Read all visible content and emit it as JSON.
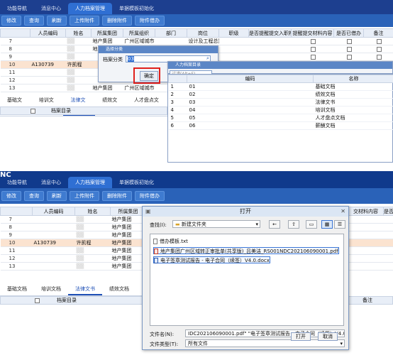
{
  "p1": {
    "nav": [
      "功能导航",
      "消息中心",
      "人力档案管理",
      "单据模板初始化"
    ],
    "toolbar": [
      "修改",
      "查询",
      "刷新",
      "上传附件",
      "删除附件",
      "附件借办"
    ],
    "headers": [
      "人员编码",
      "姓名",
      "所属集团",
      "所属组织",
      "部门",
      "岗位",
      "职级",
      "是否提醒提交入职材料",
      "提醒提交材料内容",
      "是否已借办",
      "备注"
    ],
    "rows": [
      {
        "n": "7",
        "code": "",
        "name": "",
        "org": "地产集团",
        "org2": "广州区域城市",
        "dept": "",
        "post": "设计及工程总监"
      },
      {
        "n": "8",
        "code": "",
        "name": "",
        "org": "地产集团",
        "org2": "",
        "dept": "",
        "post": ""
      },
      {
        "n": "9",
        "code": "",
        "name": "",
        "org": "",
        "org2": "",
        "dept": "",
        "post": ""
      },
      {
        "n": "10",
        "code": "A130739",
        "name": "许凯程",
        "org": "",
        "org2": "",
        "dept": "",
        "post": ""
      },
      {
        "n": "11",
        "code": "",
        "name": "",
        "org": "",
        "org2": "",
        "dept": "",
        "post": ""
      },
      {
        "n": "12",
        "code": "",
        "name": "",
        "org": "",
        "org2": "",
        "dept": "",
        "post": ""
      },
      {
        "n": "13",
        "code": "",
        "name": "",
        "org": "地产集团",
        "org2": "广州区域城市",
        "dept": "",
        "post": ""
      }
    ],
    "tabs": [
      "基础文档",
      "培训文档",
      "法律文书",
      "绩效文档",
      "人才盘点文档"
    ],
    "subhead": "档案目录",
    "dialog_title": "选择分类",
    "dialog_label": "档案分类",
    "dialog_value": "03",
    "dialog_ok": "确定",
    "dialog_cancel": "取消",
    "tree_title": "人力档案目录",
    "tree_search": "过滤(Alt+F)",
    "tree_headers": [
      "编码",
      "名称"
    ],
    "tree_rows": [
      {
        "n": "1",
        "code": "01",
        "name": "基础文档"
      },
      {
        "n": "2",
        "code": "02",
        "name": "绩效文档"
      },
      {
        "n": "3",
        "code": "03",
        "name": "法律文书"
      },
      {
        "n": "4",
        "code": "04",
        "name": "培训文档"
      },
      {
        "n": "5",
        "code": "05",
        "name": "人才盘点文档"
      },
      {
        "n": "6",
        "code": "06",
        "name": "薪酬文档"
      }
    ]
  },
  "p2": {
    "logo": "NC",
    "nav": [
      "功能导航",
      "消息中心",
      "人力档案管理",
      "单据模板初始化"
    ],
    "toolbar": [
      "修改",
      "查询",
      "刷新",
      "上传附件",
      "删除附件",
      "附件借办"
    ],
    "headers": [
      "人员编码",
      "姓名",
      "所属集团",
      "交材料内容",
      "是否"
    ],
    "rows": [
      {
        "n": "7",
        "code": "",
        "name": "",
        "org": "地产集团"
      },
      {
        "n": "8",
        "code": "",
        "name": "",
        "org": "地产集团"
      },
      {
        "n": "9",
        "code": "",
        "name": "",
        "org": "地产集团"
      },
      {
        "n": "10",
        "code": "A130739",
        "name": "许凯程",
        "org": "地产集团"
      },
      {
        "n": "11",
        "code": "",
        "name": "",
        "org": "地产集团"
      },
      {
        "n": "12",
        "code": "",
        "name": "",
        "org": "地产集团"
      },
      {
        "n": "13",
        "code": "",
        "name": "",
        "org": "地产集团"
      }
    ],
    "tabs": [
      "基础文档",
      "培训文档",
      "法律文书",
      "绩效文档"
    ],
    "subhead": "档案目录",
    "remark": "备注",
    "open": {
      "title": "打开",
      "lookin_label": "查找(I):",
      "lookin_value": "新建文件夹",
      "files": [
        {
          "name": "借办模板.txt",
          "type": "txt"
        },
        {
          "name": "地产集团广州区域转正审批单(共享版)_吕美洁_RS001NDC202106090001.pdf",
          "type": "pdf"
        },
        {
          "name": "电子签章测试报告 - 电子合同（续签）V4.0.docx",
          "type": "doc"
        }
      ],
      "filename_label": "文件名(N):",
      "filename_value": "IDC202106090001.pdf\" \"电子签章测试报告 - 电子合同（续签）V4.0.docx\"",
      "filetype_label": "文件类型(T):",
      "filetype_value": "所有文件",
      "open_btn": "打开",
      "cancel_btn": "取消"
    }
  }
}
